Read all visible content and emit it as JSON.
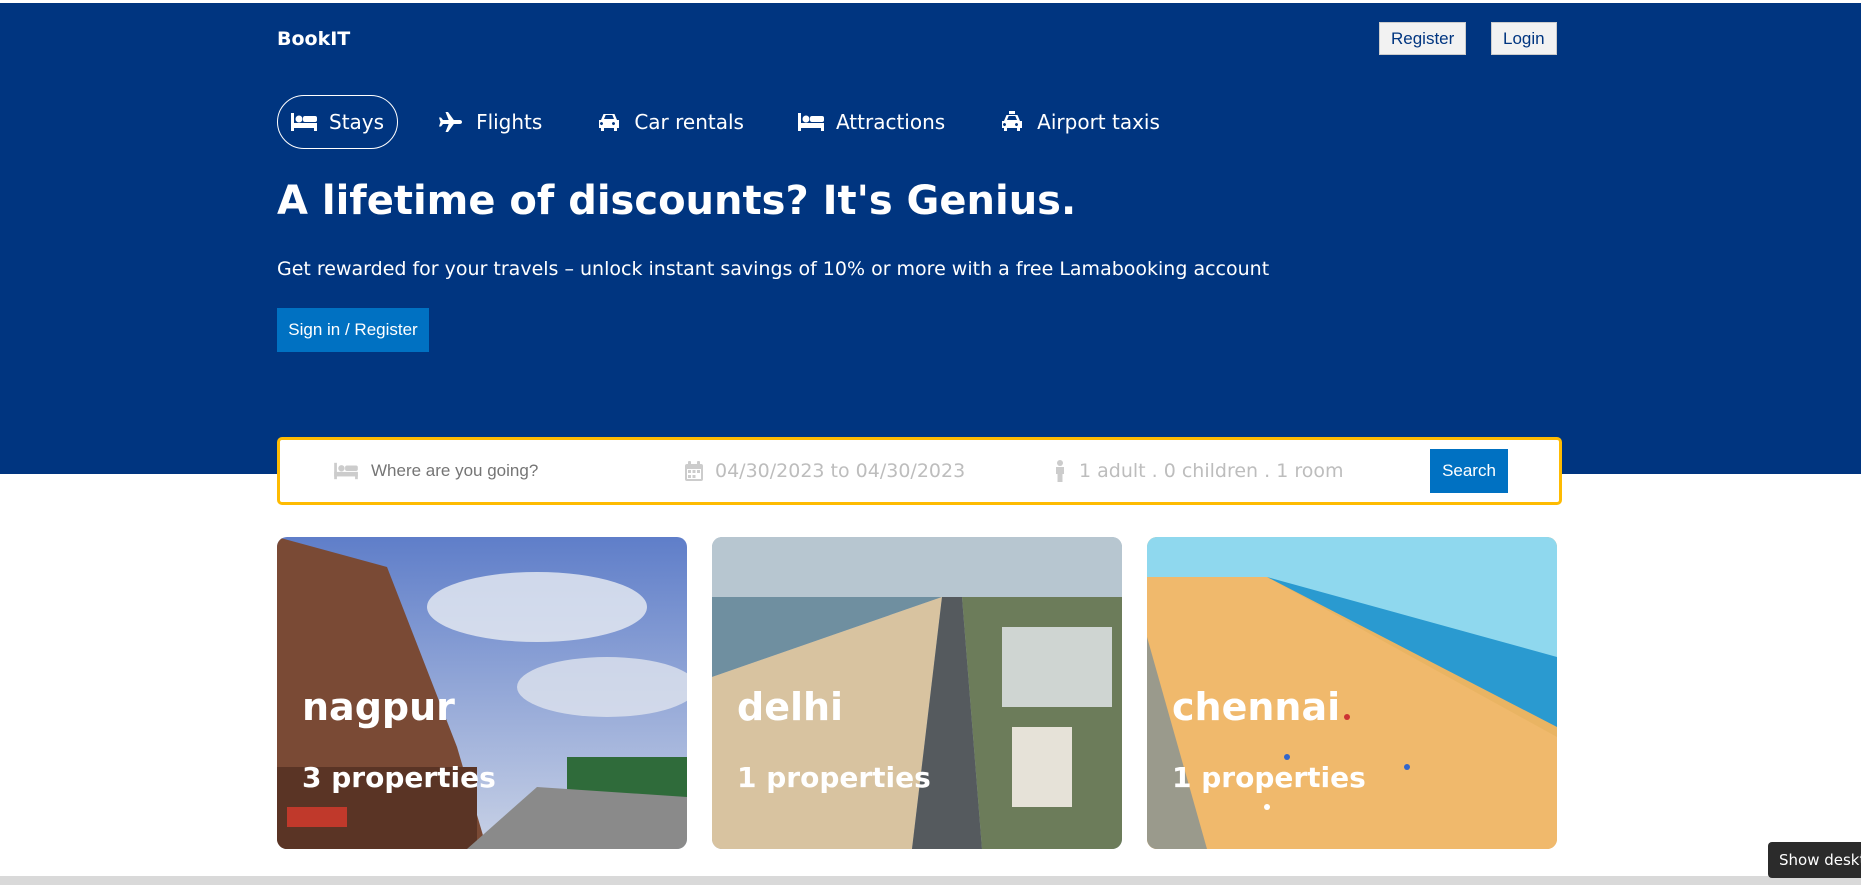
{
  "brand": {
    "logo": "BookIT"
  },
  "header_actions": {
    "register_label": "Register",
    "login_label": "Login"
  },
  "tabs": [
    {
      "label": "Stays",
      "icon": "bed-icon",
      "active": true
    },
    {
      "label": "Flights",
      "icon": "plane-icon",
      "active": false
    },
    {
      "label": "Car rentals",
      "icon": "car-icon",
      "active": false
    },
    {
      "label": "Attractions",
      "icon": "bed-icon",
      "active": false
    },
    {
      "label": "Airport taxis",
      "icon": "taxi-icon",
      "active": false
    }
  ],
  "hero": {
    "title": "A lifetime of discounts? It's Genius.",
    "description": "Get rewarded for your travels – unlock instant savings of 10% or more with a free Lamabooking account",
    "signin_label": "Sign in / Register"
  },
  "search": {
    "destination_placeholder": "Where are you going?",
    "dates": "04/30/2023 to 04/30/2023",
    "guests": "1 adult . 0 children . 1 room",
    "button_label": "Search"
  },
  "cities": [
    {
      "name": "nagpur",
      "properties": "3 properties"
    },
    {
      "name": "delhi",
      "properties": "1 properties"
    },
    {
      "name": "chennai",
      "properties": "1 properties"
    }
  ],
  "tooltip": {
    "text": "Show desktop"
  },
  "colors": {
    "header_bg": "#003580",
    "primary_button": "#0071c2",
    "search_border": "#febb02"
  }
}
